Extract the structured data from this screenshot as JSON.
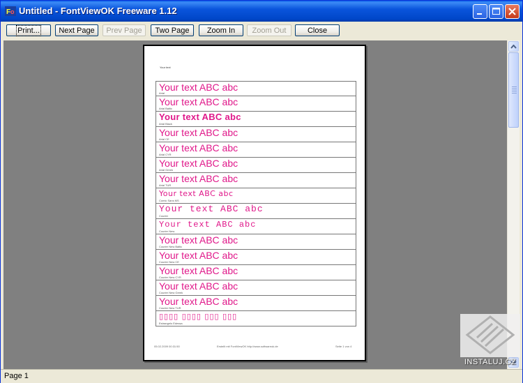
{
  "window": {
    "title": "Untitled - FontViewOK Freeware 1.12"
  },
  "toolbar": {
    "print": "Print...",
    "next_page": "Next Page",
    "prev_page": "Prev Page",
    "two_page": "Two Page",
    "zoom_in": "Zoom In",
    "zoom_out": "Zoom Out",
    "close": "Close"
  },
  "page": {
    "header_text": "Your text",
    "footer_left": "05.02.2009 00:31:50",
    "footer_center": "Erstellt mit FontViewOK http://www.softwareok.de",
    "footer_right": "Seite 1 von 4",
    "sample_color": "#e0188a",
    "rows": [
      {
        "sample": "Your text ABC abc",
        "font": "Arial"
      },
      {
        "sample": "Your text ABC abc",
        "font": "Arial Baltic"
      },
      {
        "sample": "Your text ABC abc",
        "font": "Arial Black"
      },
      {
        "sample": "Your text ABC abc",
        "font": "Arial CE"
      },
      {
        "sample": "Your text ABC abc",
        "font": "Arial CYR"
      },
      {
        "sample": "Your text ABC abc",
        "font": "Arial Greek"
      },
      {
        "sample": "Your text ABC abc",
        "font": "Arial TUR"
      },
      {
        "sample": "Your text ABC abc",
        "font": "Comic Sans MS"
      },
      {
        "sample": "Your text ABC abc",
        "font": "Courier"
      },
      {
        "sample": "Your text ABC abc",
        "font": "Courier New"
      },
      {
        "sample": "Your text ABC abc",
        "font": "Courier New Baltic"
      },
      {
        "sample": "Your text ABC abc",
        "font": "Courier New CE"
      },
      {
        "sample": "Your text ABC abc",
        "font": "Courier New CYR"
      },
      {
        "sample": "Your text ABC abc",
        "font": "Courier New Greek"
      },
      {
        "sample": "Your text ABC abc",
        "font": "Courier New TUR"
      },
      {
        "sample": "▯▯▯▯ ▯▯▯▯ ▯▯▯ ▯▯▯",
        "font": "Estrangelo Edessa"
      }
    ]
  },
  "status": {
    "page_label": "Page 1"
  },
  "watermark": {
    "text": "INSTALUJ.CZ"
  }
}
